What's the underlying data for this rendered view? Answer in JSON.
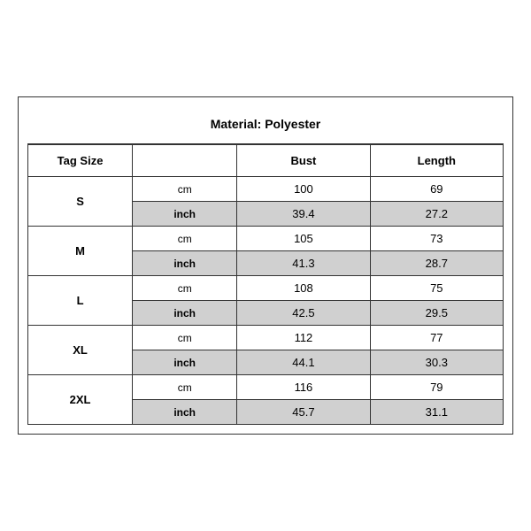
{
  "title": "Material: Polyester",
  "columns": {
    "tag_size": "Tag Size",
    "bust": "Bust",
    "length": "Length"
  },
  "sizes": [
    {
      "tag": "S",
      "cm_bust": "100",
      "cm_length": "69",
      "inch_bust": "39.4",
      "inch_length": "27.2"
    },
    {
      "tag": "M",
      "cm_bust": "105",
      "cm_length": "73",
      "inch_bust": "41.3",
      "inch_length": "28.7"
    },
    {
      "tag": "L",
      "cm_bust": "108",
      "cm_length": "75",
      "inch_bust": "42.5",
      "inch_length": "29.5"
    },
    {
      "tag": "XL",
      "cm_bust": "112",
      "cm_length": "77",
      "inch_bust": "44.1",
      "inch_length": "30.3"
    },
    {
      "tag": "2XL",
      "cm_bust": "116",
      "cm_length": "79",
      "inch_bust": "45.7",
      "inch_length": "31.1"
    }
  ],
  "units": {
    "cm": "cm",
    "inch": "inch"
  }
}
